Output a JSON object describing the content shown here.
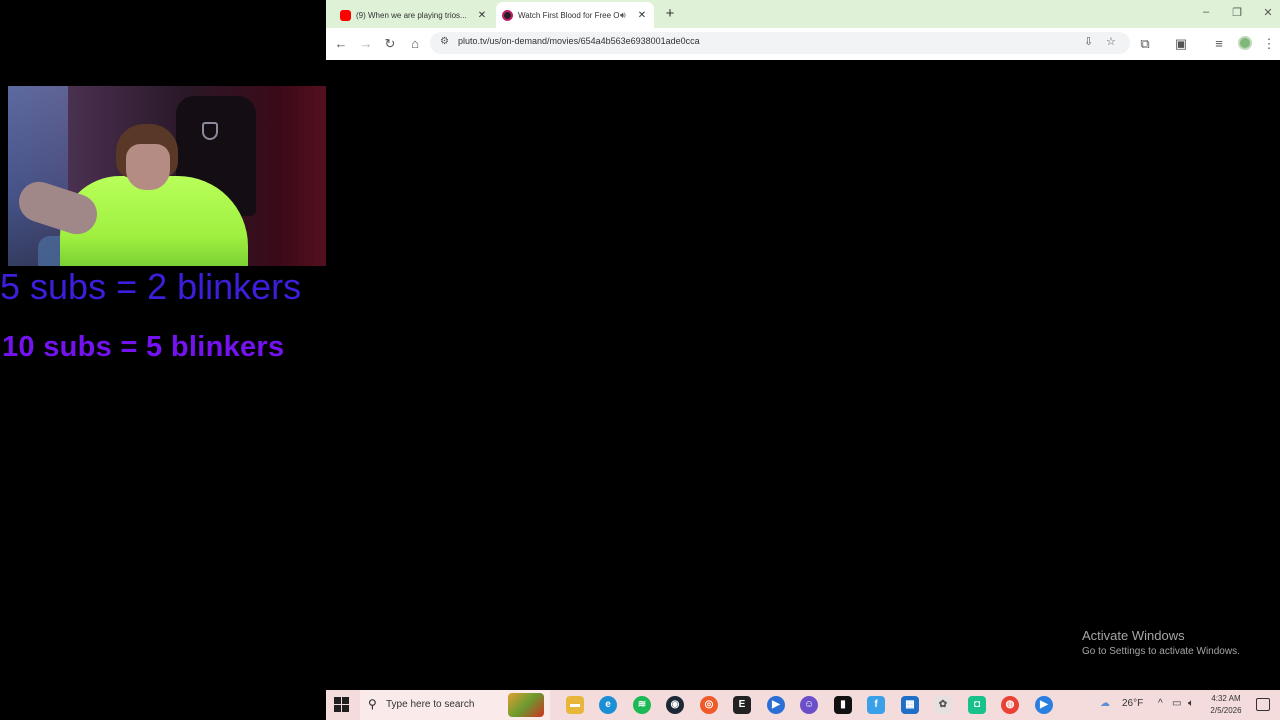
{
  "overlay": {
    "line1": "5 subs = 2 blinkers",
    "line2": "10 subs = 5 blinkers",
    "line1_color": "#3b1fdc",
    "line2_color": "#7412f0"
  },
  "browser": {
    "tabs": [
      {
        "title": "(9) When we are playing trios...",
        "icon": "youtube-icon",
        "active": false
      },
      {
        "title": "Watch First Blood for Free O",
        "icon": "pluto-tv-icon",
        "active": true
      }
    ],
    "url": "pluto.tv/us/on-demand/movies/654a4b563e6938001ade0cca",
    "accent_color": "#dff2d8"
  },
  "watermark": {
    "heading": "Activate Windows",
    "subtext": "Go to Settings to activate Windows."
  },
  "taskbar": {
    "search_placeholder": "Type here to search",
    "weather": "26°F",
    "time": "4:32 AM",
    "date": "2/5/2026",
    "color": "#f5dcdc"
  }
}
